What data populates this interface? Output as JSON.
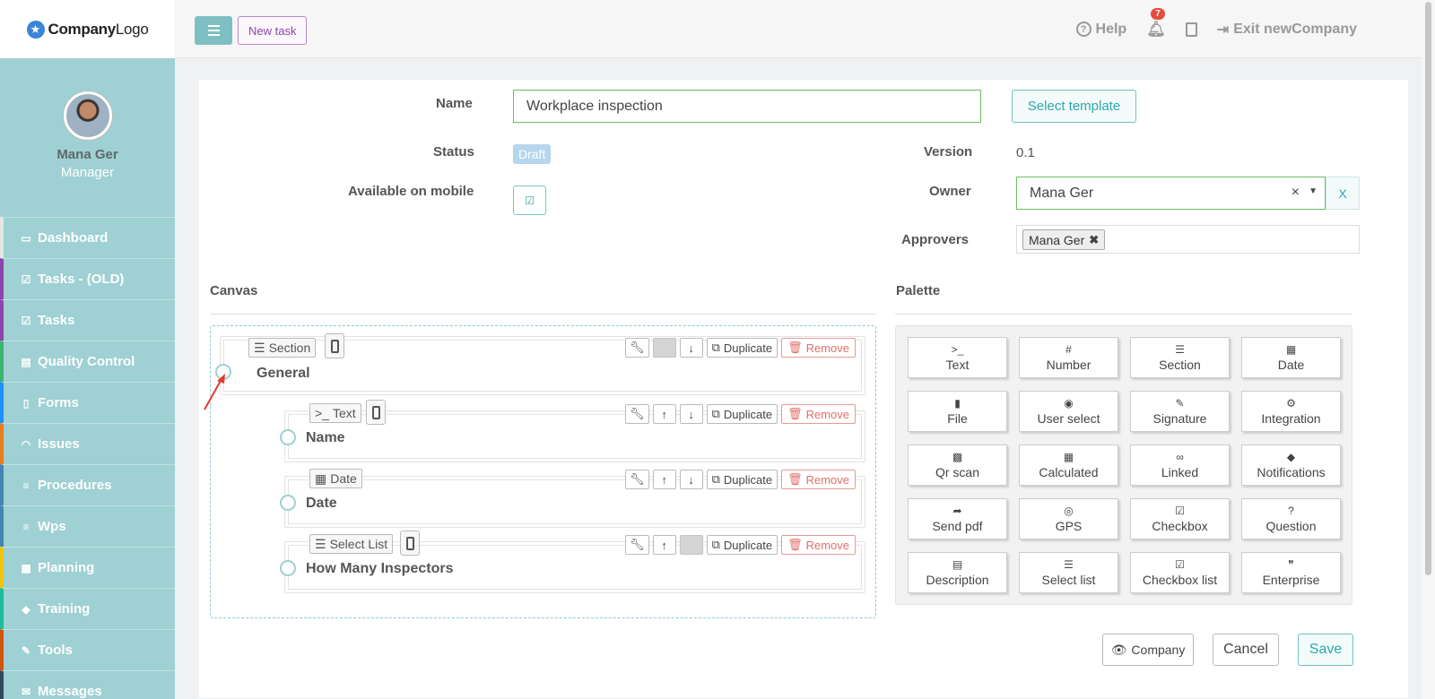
{
  "logo": {
    "brand": "Company",
    "suffix": "Logo"
  },
  "user": {
    "name": "Mana Ger",
    "role": "Manager"
  },
  "nav": [
    {
      "label": "Dashboard",
      "icon": "monitor-icon",
      "glyph": "▭",
      "color": "#e6e6e6"
    },
    {
      "label": "Tasks - (OLD)",
      "icon": "check-square-icon",
      "glyph": "☑",
      "color": "#8e44ad"
    },
    {
      "label": "Tasks",
      "icon": "check-square-icon",
      "glyph": "☑",
      "color": "#8e44ad"
    },
    {
      "label": "Quality Control",
      "icon": "book-icon",
      "glyph": "▤",
      "color": "#3cb371"
    },
    {
      "label": "Forms",
      "icon": "file-icon",
      "glyph": "▯",
      "color": "#1e90ff"
    },
    {
      "label": "Issues",
      "icon": "bell-icon",
      "glyph": "◠",
      "color": "#e67e22"
    },
    {
      "label": "Procedures",
      "icon": "list-icon",
      "glyph": "≡",
      "color": "#4682b4"
    },
    {
      "label": "Wps",
      "icon": "list-icon",
      "glyph": "≡",
      "color": "#4682b4"
    },
    {
      "label": "Planning",
      "icon": "calendar-icon",
      "glyph": "▦",
      "color": "#f1c40f"
    },
    {
      "label": "Training",
      "icon": "graduation-cap-icon",
      "glyph": "◆",
      "color": "#1abc9c"
    },
    {
      "label": "Tools",
      "icon": "wrench-icon",
      "glyph": "✎",
      "color": "#d35400"
    },
    {
      "label": "Messages",
      "icon": "envelope-icon",
      "glyph": "✉",
      "color": "#34495e"
    }
  ],
  "topbar": {
    "new_task": "New task",
    "help": "Help",
    "notifications": "7",
    "exit": "Exit newCompany"
  },
  "form": {
    "name_label": "Name",
    "name_value": "Workplace inspection",
    "select_template": "Select template",
    "status_label": "Status",
    "status_value": "Draft",
    "mobile_label": "Available on mobile",
    "version_label": "Version",
    "version_value": "0.1",
    "owner_label": "Owner",
    "owner_value": "Mana Ger",
    "owner_clear": "×",
    "owner_x": "X",
    "approvers_label": "Approvers",
    "approvers": [
      "Mana Ger"
    ]
  },
  "canvas": {
    "title": "Canvas",
    "fields": [
      {
        "type": "Section",
        "type_glyph": "☰",
        "name": "General",
        "has_phone": true
      },
      {
        "type": "Text",
        "type_glyph": ">_",
        "name": "Name",
        "has_phone": true
      },
      {
        "type": "Date",
        "type_glyph": "▦",
        "name": "Date",
        "has_phone": false
      },
      {
        "type": "Select List",
        "type_glyph": "☰",
        "name": "How Many Inspectors",
        "has_phone": true
      }
    ],
    "duplicate": "Duplicate",
    "remove": "Remove"
  },
  "palette": {
    "title": "Palette",
    "items": [
      {
        "label": "Text",
        "icon": "terminal-icon",
        "glyph": ">_"
      },
      {
        "label": "Number",
        "icon": "hash-icon",
        "glyph": "#"
      },
      {
        "label": "Section",
        "icon": "list-icon",
        "glyph": "☰"
      },
      {
        "label": "Date",
        "icon": "calendar-icon",
        "glyph": "▦"
      },
      {
        "label": "File",
        "icon": "file-icon",
        "glyph": "▮"
      },
      {
        "label": "User select",
        "icon": "user-circle-icon",
        "glyph": "◉"
      },
      {
        "label": "Signature",
        "icon": "pen-square-icon",
        "glyph": "✎"
      },
      {
        "label": "Integration",
        "icon": "cogs-icon",
        "glyph": "⚙"
      },
      {
        "label": "Qr scan",
        "icon": "qrcode-icon",
        "glyph": "▩"
      },
      {
        "label": "Calculated",
        "icon": "calculator-icon",
        "glyph": "▦"
      },
      {
        "label": "Linked",
        "icon": "link-icon",
        "glyph": "∞"
      },
      {
        "label": "Notifications",
        "icon": "bell-icon",
        "glyph": "◆"
      },
      {
        "label": "Send pdf",
        "icon": "share-square-icon",
        "glyph": "➦"
      },
      {
        "label": "GPS",
        "icon": "compass-icon",
        "glyph": "◎"
      },
      {
        "label": "Checkbox",
        "icon": "check-square-icon",
        "glyph": "☑"
      },
      {
        "label": "Question",
        "icon": "question-circle-icon",
        "glyph": "?"
      },
      {
        "label": "Description",
        "icon": "file-text-icon",
        "glyph": "▤"
      },
      {
        "label": "Select list",
        "icon": "list-ol-icon",
        "glyph": "☰"
      },
      {
        "label": "Checkbox list",
        "icon": "check-square-icon",
        "glyph": "☑"
      },
      {
        "label": "Enterprise",
        "icon": "quote-icon",
        "glyph": "❞"
      }
    ]
  },
  "footer": {
    "company": "Company",
    "cancel": "Cancel",
    "save": "Save"
  },
  "colors": {
    "sidebar": "#9fd0d3",
    "accent": "#2aa8b0",
    "danger": "#e0706b",
    "valid_border": "#6bbf5f"
  }
}
